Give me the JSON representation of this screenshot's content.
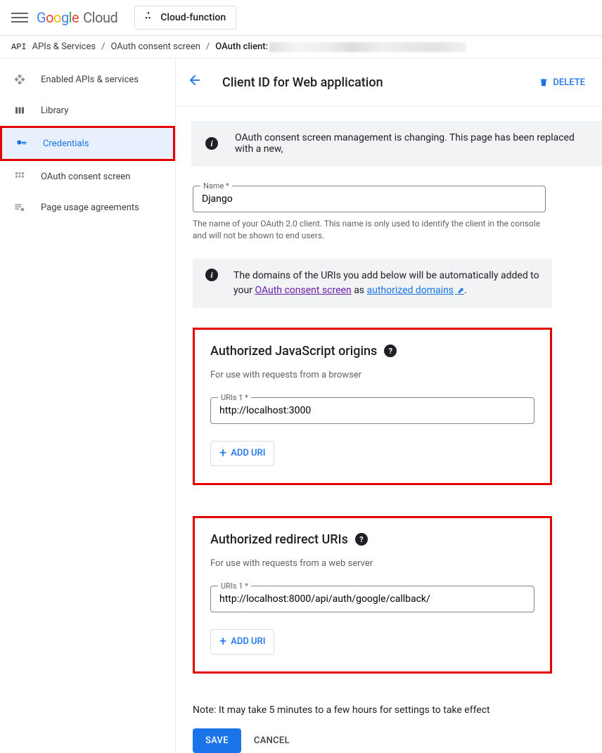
{
  "header": {
    "brand_cloud": "Cloud",
    "project": "Cloud-function"
  },
  "breadcrumbs": {
    "api_badge": "API",
    "items": [
      "APIs & Services",
      "OAuth consent screen",
      "OAuth client:"
    ]
  },
  "sidebar": {
    "items": [
      {
        "icon": "diamond",
        "label": "Enabled APIs & services"
      },
      {
        "icon": "library",
        "label": "Library"
      },
      {
        "icon": "key",
        "label": "Credentials"
      },
      {
        "icon": "consent",
        "label": "OAuth consent screen"
      },
      {
        "icon": "gear",
        "label": "Page usage agreements"
      }
    ]
  },
  "page": {
    "title": "Client ID for Web application",
    "delete_label": "DELETE",
    "banner": "OAuth consent screen management is changing. This page has been replaced with a new,",
    "name_label": "Name *",
    "name_value": "Django",
    "name_help": "The name of your OAuth 2.0 client. This name is only used to identify the client in the console and will not be shown to end users.",
    "domain_info_prefix": "The domains of the URIs you add below will be automatically added to your ",
    "domain_link1": "OAuth consent screen",
    "domain_info_mid": " as ",
    "domain_link2": "authorized domains",
    "js_origins": {
      "title": "Authorized JavaScript origins",
      "sub": "For use with requests from a browser",
      "uri_label": "URIs 1 *",
      "uri_value": "http://localhost:3000",
      "add_label": "ADD URI"
    },
    "redirect": {
      "title": "Authorized redirect URIs",
      "sub": "For use with requests from a web server",
      "uri_label": "URIs 1 *",
      "uri_value": "http://localhost:8000/api/auth/google/callback/",
      "add_label": "ADD URI"
    },
    "note": "Note: It may take 5 minutes to a few hours for settings to take effect",
    "save": "SAVE",
    "cancel": "CANCEL"
  }
}
